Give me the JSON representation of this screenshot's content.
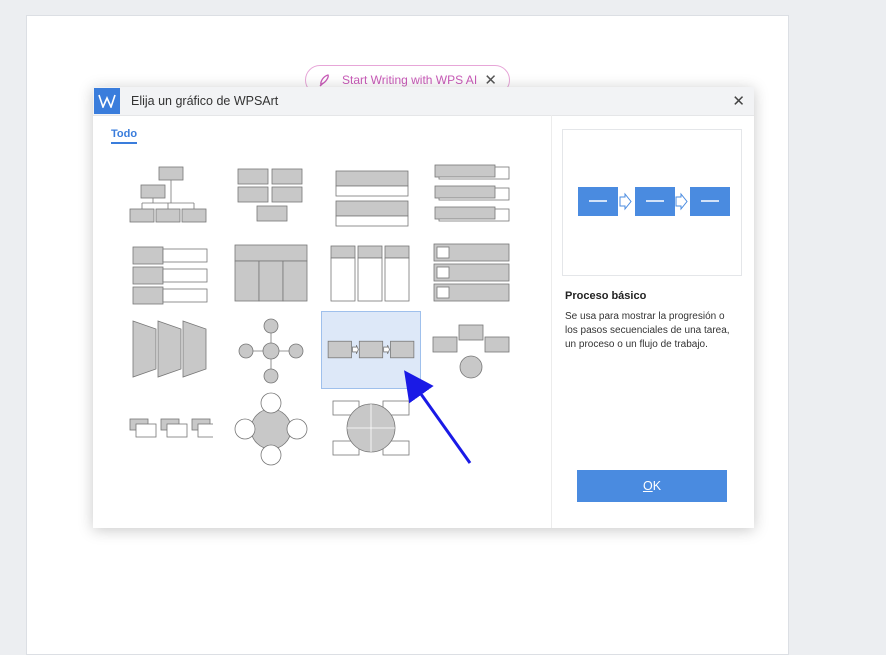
{
  "ai_bar": {
    "label": "Start Writing with WPS AI",
    "close_glyph": "✕"
  },
  "dialog": {
    "title": "Elija un gráfico de WPSArt",
    "close_glyph": "✕",
    "tab_all": "Todo"
  },
  "gallery": {
    "items": [
      {
        "name": "organization-chart"
      },
      {
        "name": "hierarchy-blocks"
      },
      {
        "name": "vertical-bullet-list"
      },
      {
        "name": "stacked-list"
      },
      {
        "name": "vertical-box-list"
      },
      {
        "name": "table-hierarchy"
      },
      {
        "name": "column-list"
      },
      {
        "name": "vertical-picture-list"
      },
      {
        "name": "trapezoid-list"
      },
      {
        "name": "diverging-radial"
      },
      {
        "name": "basic-process",
        "selected": true
      },
      {
        "name": "converging-process"
      },
      {
        "name": "step-up-process"
      },
      {
        "name": "basic-radial"
      },
      {
        "name": "cycle-matrix"
      }
    ]
  },
  "preview": {
    "title": "Proceso básico",
    "description": "Se usa para mostrar la progresión o los pasos secuenciales de una tarea, un proceso o un flujo de trabajo."
  },
  "ok_button": {
    "label": "OK",
    "accent_letter": "O",
    "rest": "K"
  },
  "colors": {
    "accent": "#3a7ddc",
    "preview_box_fill": "#4a8be0",
    "annotation_arrow": "#1a1ae6",
    "selected_bg": "#dde8f8"
  }
}
